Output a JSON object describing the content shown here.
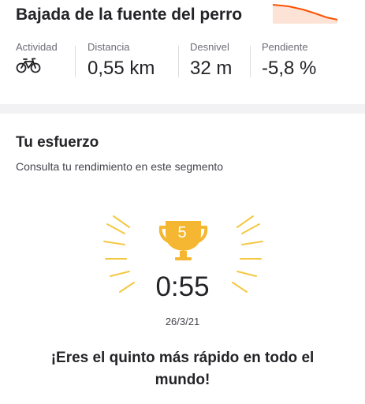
{
  "segment": {
    "title": "Bajada de la fuente del perro",
    "elevation_profile_color": "#fc5200"
  },
  "stats": {
    "activity_label": "Actividad",
    "activity_icon": "bike-icon",
    "distance_label": "Distancia",
    "distance_value": "0,55 km",
    "elevation_label": "Desnivel",
    "elevation_value": "32 m",
    "grade_label": "Pendiente",
    "grade_value": "-5,8 %"
  },
  "effort": {
    "title": "Tu esfuerzo",
    "subtitle": "Consulta tu rendimiento en este segmento",
    "trophy_icon": "trophy-icon",
    "trophy_color": "#f5b731",
    "rank": "5",
    "time": "0:55",
    "date": "26/3/21",
    "message": "¡Eres el quinto más rápido en todo el mundo!"
  }
}
